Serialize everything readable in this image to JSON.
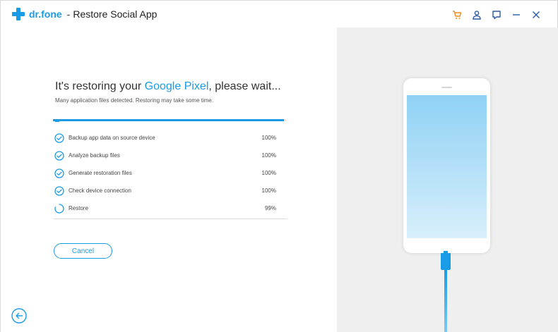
{
  "app": {
    "brand": "dr.fone",
    "separator": "-",
    "title": "Restore Social App"
  },
  "titlebar": {
    "icons": [
      "cart-icon",
      "user-icon",
      "feedback-icon",
      "minimize-icon",
      "close-icon"
    ]
  },
  "main": {
    "heading_prefix": "It's restoring your ",
    "device_name": "Google Pixel",
    "heading_suffix": ", please wait...",
    "subtext": "Many application files detected. Restoring may take some time.",
    "overall_progress_percent": 99,
    "steps": [
      {
        "label": "Backup app data on source device",
        "percent": "100%",
        "status": "done"
      },
      {
        "label": "Analyze backup files",
        "percent": "100%",
        "status": "done"
      },
      {
        "label": "Generate restoration files",
        "percent": "100%",
        "status": "done"
      },
      {
        "label": "Check device connection",
        "percent": "100%",
        "status": "done"
      },
      {
        "label": "Restore",
        "percent": "99%",
        "status": "in-progress"
      }
    ],
    "cancel_label": "Cancel"
  },
  "colors": {
    "accent": "#1a9be6",
    "cart_icon": "#f08c1e",
    "right_panel_bg": "#efefef"
  }
}
